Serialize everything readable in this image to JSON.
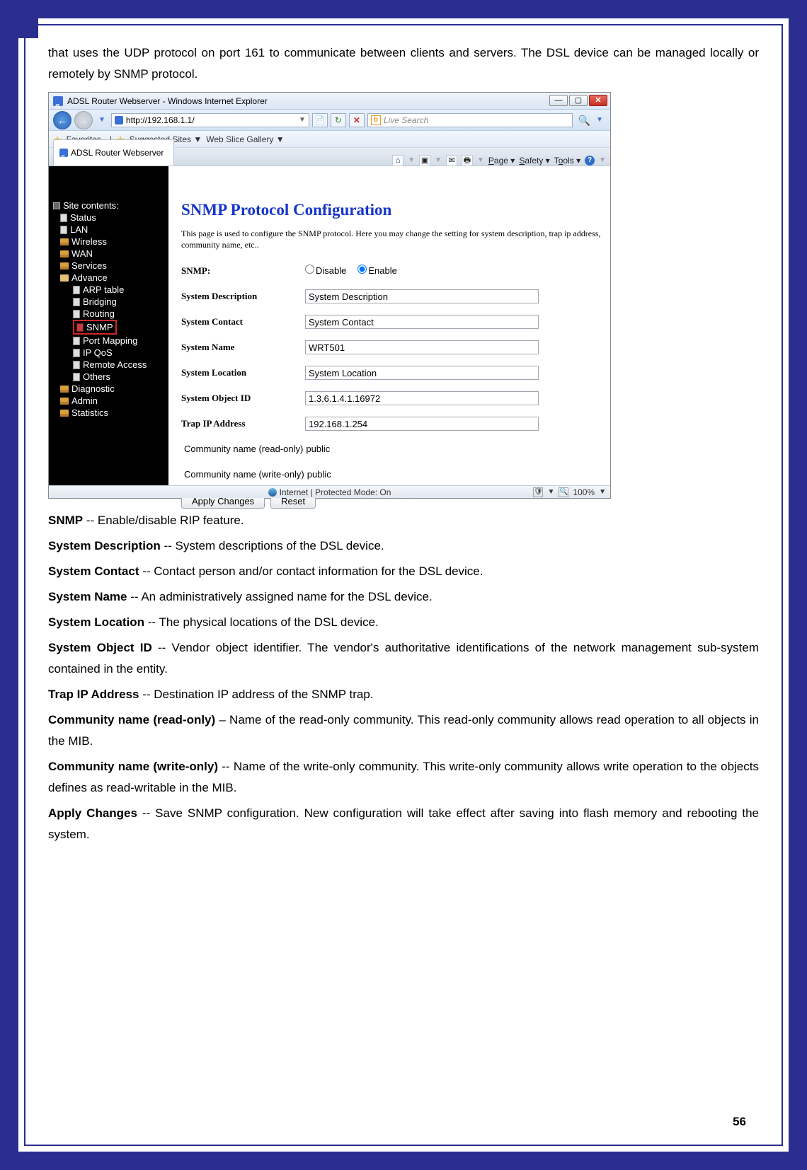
{
  "doc": {
    "intro": "that uses the UDP protocol on port 161 to communicate between clients and servers. The DSL device can be managed locally or remotely by SNMP protocol.",
    "page_number": "56",
    "defs": {
      "snmp_b": "SNMP",
      "snmp_t": " -- Enable/disable RIP feature.",
      "sysdesc_b": "System Description",
      "sysdesc_t": " -- System descriptions of the DSL device.",
      "syscontact_b": "System Contact",
      "syscontact_t": " -- Contact person and/or contact information for the DSL device.",
      "sysname_b": "System Name",
      "sysname_t": " -- An administratively assigned name for the DSL device.",
      "sysloc_b": "System Location",
      "sysloc_t": " -- The physical locations of the DSL device.",
      "sysobj_b": "System Object ID",
      "sysobj_t": " -- Vendor object identifier. The vendor's authoritative identifications of the network management sub-system contained in the entity.",
      "trap_b": "Trap IP Address",
      "trap_t": " -- Destination IP address of the SNMP trap.",
      "comro_b": "Community name (read-only)",
      "comro_t": " – Name of the read-only community. This read-only community allows read operation to all objects in the MIB.",
      "comwo_b": "Community name (write-only)",
      "comwo_t": " -- Name of the write-only community. This write-only community allows write operation to the objects defines as read-writable in the MIB.",
      "apply_b": "Apply Changes",
      "apply_t": " -- Save SNMP configuration. New configuration will take effect after saving into flash memory and rebooting the system."
    }
  },
  "ie": {
    "title": "ADSL Router Webserver - Windows Internet Explorer",
    "url": "http://192.168.1.1/",
    "search_ph": "Live Search",
    "fav": "Favorites",
    "suggested": "Suggested Sites",
    "webslice": "Web Slice Gallery",
    "tab": "ADSL Router Webserver",
    "cmd_page": "Page",
    "cmd_safety": "Safety",
    "cmd_tools": "Tools",
    "status_text": "Internet | Protected Mode: On",
    "zoom": "100%"
  },
  "sidebar": {
    "header": "Site contents:",
    "status": "Status",
    "lan": "LAN",
    "wireless": "Wireless",
    "wan": "WAN",
    "services": "Services",
    "advance": "Advance",
    "arp": "ARP table",
    "bridging": "Bridging",
    "routing": "Routing",
    "snmp": "SNMP",
    "portmap": "Port Mapping",
    "ipqos": "IP QoS",
    "remote": "Remote Access",
    "others": "Others",
    "diag": "Diagnostic",
    "admin": "Admin",
    "stats": "Statistics"
  },
  "form": {
    "heading": "SNMP Protocol Configuration",
    "desc": "This page is used to configure the SNMP protocol. Here you may change the setting for system description, trap ip address, community name, etc..",
    "snmp_lbl": "SNMP:",
    "disable": "Disable",
    "enable": "Enable",
    "sysdesc_lbl": "System Description",
    "sysdesc_val": "System Description",
    "syscontact_lbl": "System Contact",
    "syscontact_val": "System Contact",
    "sysname_lbl": "System Name",
    "sysname_val": "WRT501",
    "sysloc_lbl": "System Location",
    "sysloc_val": "System Location",
    "sysobj_lbl": "System Object ID",
    "sysobj_val": "1.3.6.1.4.1.16972",
    "trap_lbl": "Trap IP Address",
    "trap_val": "192.168.1.254",
    "comro_lbl": "Community name (read-only)",
    "comro_val": "public",
    "comwo_lbl": "Community name (write-only)",
    "comwo_val": "public",
    "apply": "Apply Changes",
    "reset": "Reset"
  }
}
